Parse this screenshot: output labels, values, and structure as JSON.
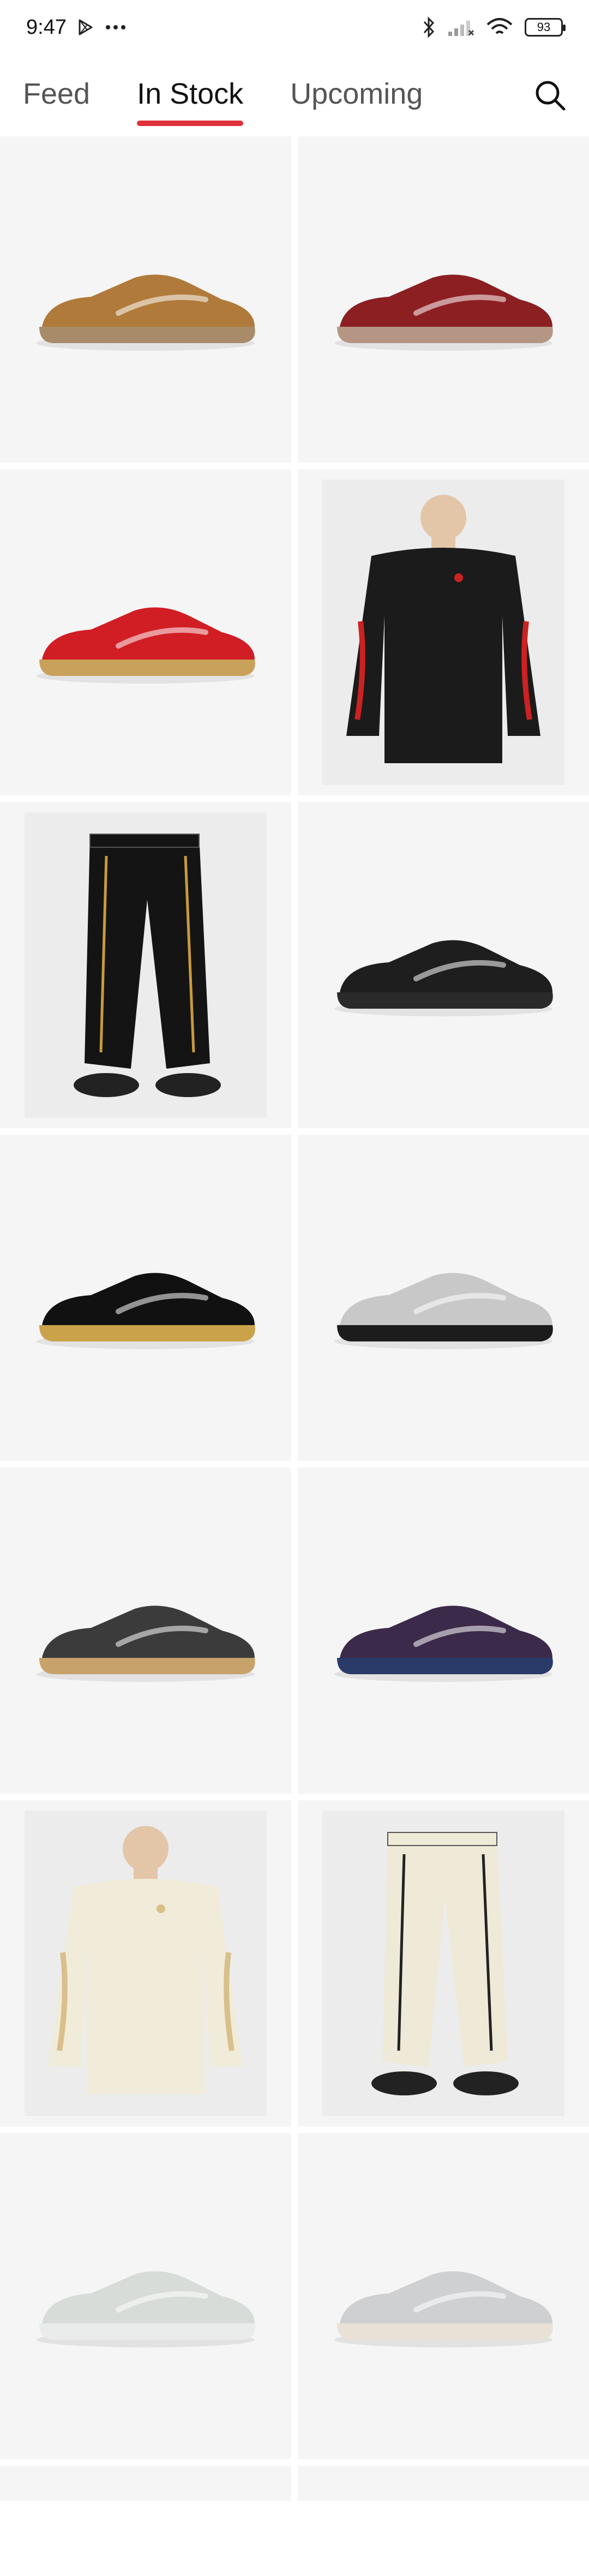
{
  "status": {
    "time": "9:47",
    "battery": "93"
  },
  "tabs": [
    {
      "label": "Feed"
    },
    {
      "label": "In Stock"
    },
    {
      "label": "Upcoming"
    }
  ],
  "products": [
    {
      "item": "shoe",
      "colors": {
        "upper": "#b07a3a",
        "sole": "#a88c6a"
      }
    },
    {
      "item": "shoe",
      "colors": {
        "upper": "#8c1f22",
        "sole": "#b59684"
      }
    },
    {
      "item": "shoe",
      "colors": {
        "upper": "#d11d24",
        "sole": "#c9a15a"
      }
    },
    {
      "item": "jacket",
      "colors": {
        "main": "#1b1b1b",
        "accent": "#cc2222"
      }
    },
    {
      "item": "pants",
      "colors": {
        "main": "#141414",
        "accent": "#c99b3c"
      }
    },
    {
      "item": "shoe",
      "colors": {
        "upper": "#1e1e1e",
        "sole": "#2a2a2a"
      }
    },
    {
      "item": "shoe",
      "colors": {
        "upper": "#111111",
        "sole": "#c9a24a"
      }
    },
    {
      "item": "shoe",
      "colors": {
        "upper": "#c8c8c8",
        "sole": "#1c1c1c"
      }
    },
    {
      "item": "shoe",
      "colors": {
        "upper": "#3b3b3b",
        "sole": "#c7a36b"
      }
    },
    {
      "item": "shoe",
      "colors": {
        "upper": "#3c2a4a",
        "sole": "#2a3b6a"
      }
    },
    {
      "item": "sweatshirt",
      "colors": {
        "main": "#f1ebd9",
        "accent": "#d9bf8a"
      }
    },
    {
      "item": "pants",
      "colors": {
        "main": "#efe9d8",
        "accent": "#222222"
      }
    },
    {
      "item": "shoe",
      "colors": {
        "upper": "#d7dcd8",
        "sole": "#e9ecea"
      }
    },
    {
      "item": "shoe",
      "colors": {
        "upper": "#cfd0d2",
        "sole": "#e8e2d6"
      }
    }
  ],
  "theme": {
    "accent": "#e0313a",
    "tile_bg": "#f5f5f5"
  }
}
